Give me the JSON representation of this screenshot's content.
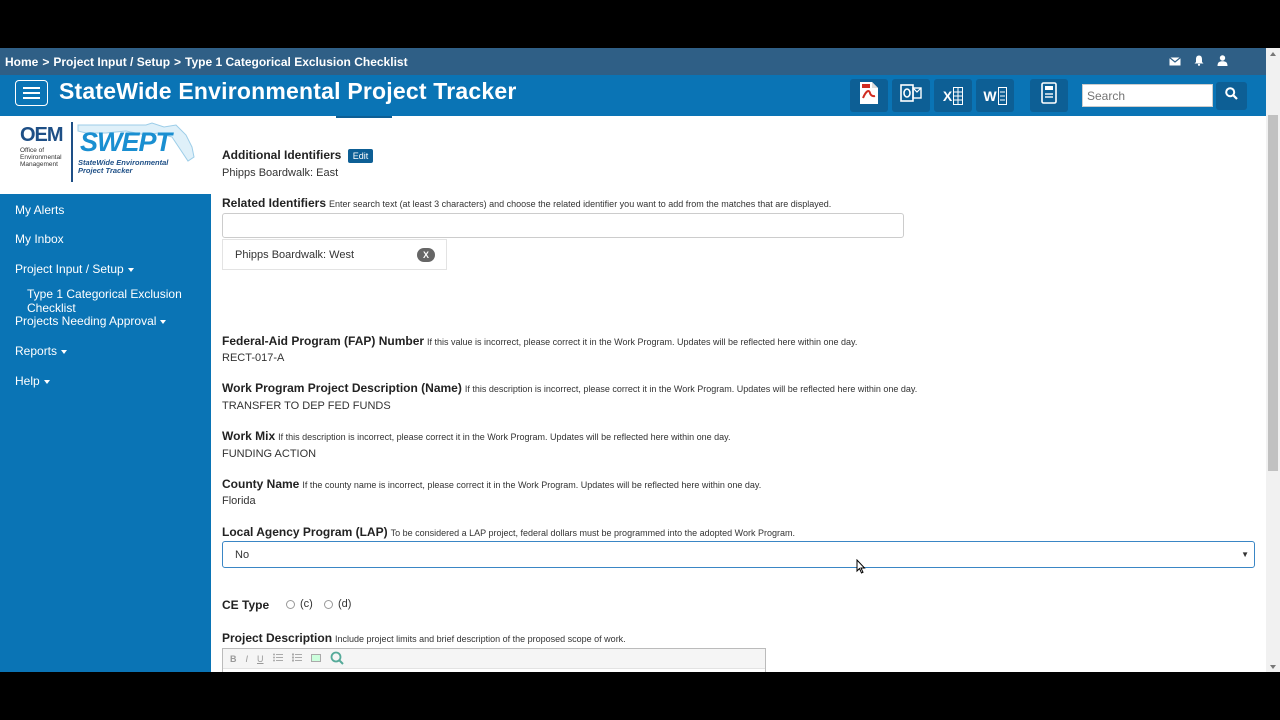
{
  "breadcrumb": {
    "items": [
      "Home",
      "Project Input / Setup",
      "Type 1 Categorical Exclusion Checklist"
    ],
    "separator": ">"
  },
  "header": {
    "title": "StateWide Environmental Project Tracker",
    "tools": [
      "pdf-export-icon",
      "outlook-export-icon",
      "excel-export-icon",
      "word-export-icon",
      "save-document-icon"
    ],
    "excel_letter": "X",
    "word_letter": "W",
    "search_placeholder": "Search"
  },
  "logo": {
    "oem": "OEM",
    "oem_sub": "Office of Environmental Management",
    "swept": "SWEPT",
    "swept_sub": "StateWide Environmental Project Tracker"
  },
  "sidebar": {
    "my_alerts": "My Alerts",
    "my_inbox": "My Inbox",
    "project_input": "Project Input / Setup",
    "type1": "Type 1 Categorical Exclusion Checklist",
    "projects_needing_approval": "Projects Needing Approval",
    "reports": "Reports",
    "help": "Help"
  },
  "form": {
    "additional_identifiers": {
      "label": "Additional Identifiers",
      "edit": "Edit",
      "value": "Phipps Boardwalk: East"
    },
    "related_identifiers": {
      "label": "Related Identifiers",
      "help": "Enter search text (at least 3 characters) and choose the related identifier you want to add from the matches that are displayed.",
      "chip": "Phipps Boardwalk: West",
      "chip_remove": "X"
    },
    "fap": {
      "label": "Federal-Aid Program (FAP) Number",
      "help": "If this value is incorrect, please correct it in the Work Program. Updates will be reflected here within one day.",
      "value": "RECT-017-A"
    },
    "wp_description": {
      "label": "Work Program Project Description (Name)",
      "help": "If this description is incorrect, please correct it in the Work Program. Updates will be reflected here within one day.",
      "value": "TRANSFER TO DEP FED FUNDS"
    },
    "work_mix": {
      "label": "Work Mix",
      "help": "If this description is incorrect, please correct it in the Work Program. Updates will be reflected here within one day.",
      "value": "FUNDING ACTION"
    },
    "county": {
      "label": "County Name",
      "help": "If the county name is incorrect, please correct it in the Work Program. Updates will be reflected here within one day.",
      "value": "Florida"
    },
    "lap": {
      "label": "Local Agency Program (LAP)",
      "help": "To be considered a LAP project, federal dollars must be programmed into the adopted Work Program.",
      "selected": "No"
    },
    "ce_type": {
      "label": "CE Type",
      "option_c": "(c)",
      "option_d": "(d)"
    },
    "project_description": {
      "label": "Project Description",
      "help": "Include project limits and brief description of the proposed scope of work.",
      "toolbar": [
        "B",
        "I",
        "U"
      ]
    }
  },
  "colors": {
    "breadcrumb_bg": "#2f5f86",
    "header_bg": "#0a74b5",
    "sidebar_bg": "#0a74b5",
    "accent": "#0d5f95"
  }
}
